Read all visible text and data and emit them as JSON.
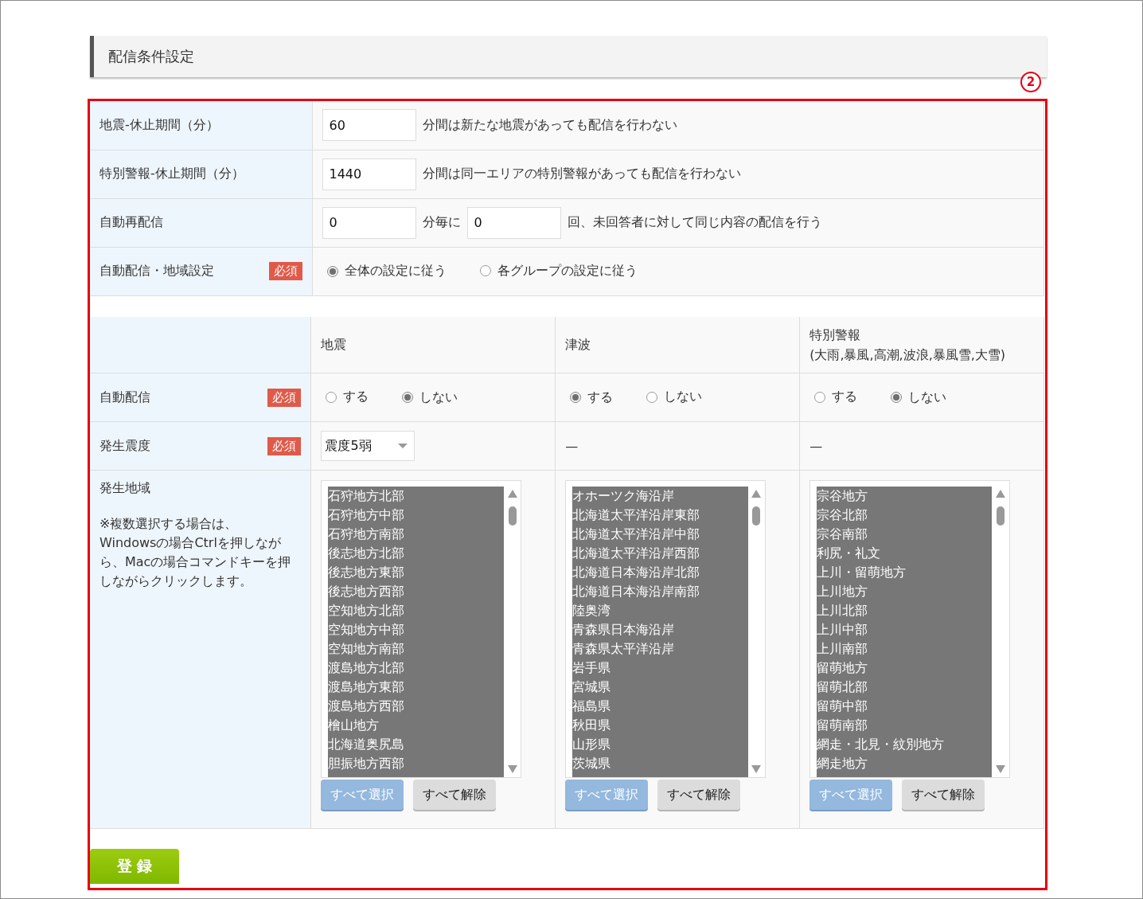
{
  "section_title": "配信条件設定",
  "annotation": "2",
  "settings": [
    {
      "label": "地震-休止期間（分）",
      "parts": [
        {
          "kind": "field",
          "value": "60"
        },
        {
          "kind": "text",
          "text": "分間は新たな地震があっても配信を行わない"
        }
      ]
    },
    {
      "label": "特別警報-休止期間（分）",
      "parts": [
        {
          "kind": "field",
          "value": "1440"
        },
        {
          "kind": "text",
          "text": "分間は同一エリアの特別警報があっても配信を行わない"
        }
      ]
    },
    {
      "label": "自動再配信",
      "parts": [
        {
          "kind": "field",
          "value": "0"
        },
        {
          "kind": "text",
          "text": "分毎に"
        },
        {
          "kind": "field",
          "value": "0"
        },
        {
          "kind": "text",
          "text": "回、未回答者に対して同じ内容の配信を行う"
        }
      ]
    },
    {
      "label": "自動配信・地域設定",
      "badge": "必須",
      "parts": [
        {
          "kind": "radios",
          "options": [
            {
              "label": "全体の設定に従う",
              "selected": true
            },
            {
              "label": "各グループの設定に従う",
              "selected": false
            }
          ]
        }
      ]
    }
  ],
  "grid": {
    "columns": [
      {
        "title": "地震"
      },
      {
        "title": "津波"
      },
      {
        "title": "特別警報",
        "subtitle": "(大雨,暴風,高潮,波浪,暴風雪,大雪)"
      }
    ],
    "rows": [
      {
        "label": "自動配信",
        "badge": "必須",
        "cells": [
          {
            "kind": "radios",
            "options": [
              {
                "label": "する",
                "selected": false
              },
              {
                "label": "しない",
                "selected": true
              }
            ]
          },
          {
            "kind": "radios",
            "options": [
              {
                "label": "する",
                "selected": true
              },
              {
                "label": "しない",
                "selected": false
              }
            ]
          },
          {
            "kind": "radios",
            "options": [
              {
                "label": "する",
                "selected": false
              },
              {
                "label": "しない",
                "selected": true
              }
            ]
          }
        ]
      },
      {
        "label": "発生震度",
        "badge": "必須",
        "cells": [
          {
            "kind": "select",
            "value": "震度5弱"
          },
          {
            "kind": "text",
            "text": "—"
          },
          {
            "kind": "text",
            "text": "—"
          }
        ]
      },
      {
        "label": "発生地域",
        "note": [
          "※複数選択する場合は、",
          "Windowsの場合Ctrlを押しながら、Macの場合コマンドキーを押しながらクリックします。"
        ],
        "cells": [
          {
            "kind": "listbox",
            "items": [
              {
                "text": "石狩地方北部",
                "selected": true
              },
              {
                "text": "石狩地方中部",
                "selected": true
              },
              {
                "text": "石狩地方南部",
                "selected": true
              },
              {
                "text": "後志地方北部",
                "selected": true
              },
              {
                "text": "後志地方東部",
                "selected": true
              },
              {
                "text": "後志地方西部",
                "selected": true
              },
              {
                "text": "空知地方北部",
                "selected": true
              },
              {
                "text": "空知地方中部",
                "selected": true
              },
              {
                "text": "空知地方南部",
                "selected": true
              },
              {
                "text": "渡島地方北部",
                "selected": true
              },
              {
                "text": "渡島地方東部",
                "selected": true
              },
              {
                "text": "渡島地方西部",
                "selected": true
              },
              {
                "text": "檜山地方",
                "selected": true
              },
              {
                "text": "北海道奥尻島",
                "selected": true
              },
              {
                "text": "胆振地方西部",
                "selected": true
              }
            ],
            "buttons": [
              {
                "label": "すべて選択",
                "kind": "primary"
              },
              {
                "label": "すべて解除",
                "kind": "secondary"
              }
            ]
          },
          {
            "kind": "listbox",
            "items": [
              {
                "text": "オホーツク海沿岸",
                "selected": true
              },
              {
                "text": "北海道太平洋沿岸東部",
                "selected": true
              },
              {
                "text": "北海道太平洋沿岸中部",
                "selected": true
              },
              {
                "text": "北海道太平洋沿岸西部",
                "selected": true
              },
              {
                "text": "北海道日本海沿岸北部",
                "selected": true
              },
              {
                "text": "北海道日本海沿岸南部",
                "selected": true
              },
              {
                "text": "陸奥湾",
                "selected": true
              },
              {
                "text": "青森県日本海沿岸",
                "selected": true
              },
              {
                "text": "青森県太平洋沿岸",
                "selected": true
              },
              {
                "text": "岩手県",
                "selected": true
              },
              {
                "text": "宮城県",
                "selected": true
              },
              {
                "text": "福島県",
                "selected": true
              },
              {
                "text": "秋田県",
                "selected": true
              },
              {
                "text": "山形県",
                "selected": true
              },
              {
                "text": "茨城県",
                "selected": true
              }
            ],
            "buttons": [
              {
                "label": "すべて選択",
                "kind": "primary"
              },
              {
                "label": "すべて解除",
                "kind": "secondary"
              }
            ]
          },
          {
            "kind": "listbox",
            "items": [
              {
                "text": "宗谷地方",
                "selected": true
              },
              {
                "text": "宗谷北部",
                "selected": true
              },
              {
                "text": "宗谷南部",
                "selected": true
              },
              {
                "text": "利尻・礼文",
                "selected": true
              },
              {
                "text": "上川・留萌地方",
                "selected": true
              },
              {
                "text": "上川地方",
                "selected": true
              },
              {
                "text": "上川北部",
                "selected": true
              },
              {
                "text": "上川中部",
                "selected": true
              },
              {
                "text": "上川南部",
                "selected": true
              },
              {
                "text": "留萌地方",
                "selected": true
              },
              {
                "text": "留萌北部",
                "selected": true
              },
              {
                "text": "留萌中部",
                "selected": true
              },
              {
                "text": "留萌南部",
                "selected": true
              },
              {
                "text": "網走・北見・紋別地方",
                "selected": true
              },
              {
                "text": "網走地方",
                "selected": true
              }
            ],
            "buttons": [
              {
                "label": "すべて選択",
                "kind": "primary"
              },
              {
                "label": "すべて解除",
                "kind": "secondary"
              }
            ]
          }
        ]
      }
    ]
  },
  "submit": "登 録"
}
